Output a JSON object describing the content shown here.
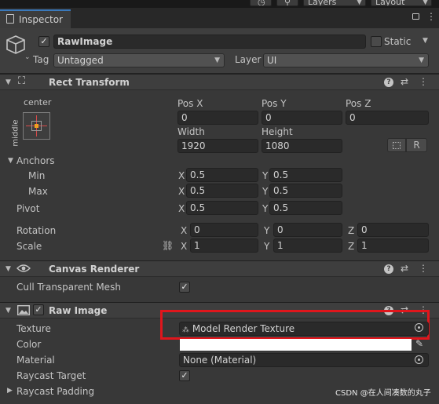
{
  "toolbar": {
    "layers_label": "Layers",
    "layout_label": "Layout"
  },
  "tab": {
    "label": "Inspector"
  },
  "header": {
    "object_name": "RawImage",
    "static_label": "Static",
    "tag_label": "Tag",
    "tag_value": "Untagged",
    "layer_label": "Layer",
    "layer_value": "UI"
  },
  "rect_transform": {
    "title": "Rect Transform",
    "anchor_preset_h": "center",
    "anchor_preset_v": "middle",
    "pos_x_label": "Pos X",
    "pos_x": "0",
    "pos_y_label": "Pos Y",
    "pos_y": "0",
    "pos_z_label": "Pos Z",
    "pos_z": "0",
    "width_label": "Width",
    "width": "1920",
    "height_label": "Height",
    "height": "1080",
    "r_label": "R",
    "anchors_label": "Anchors",
    "min_label": "Min",
    "min_x": "0.5",
    "min_y": "0.5",
    "max_label": "Max",
    "max_x": "0.5",
    "max_y": "0.5",
    "pivot_label": "Pivot",
    "pivot_x": "0.5",
    "pivot_y": "0.5",
    "rotation_label": "Rotation",
    "rot_x": "0",
    "rot_y": "0",
    "rot_z": "0",
    "scale_label": "Scale",
    "scale_x": "1",
    "scale_y": "1",
    "scale_z": "1",
    "x_axis": "X",
    "y_axis": "Y",
    "z_axis": "Z"
  },
  "canvas_renderer": {
    "title": "Canvas Renderer",
    "cull_label": "Cull Transparent Mesh",
    "cull_checked": true
  },
  "raw_image": {
    "title": "Raw Image",
    "texture_label": "Texture",
    "texture_value": "Model Render Texture",
    "color_label": "Color",
    "color_value": "#ffffff",
    "material_label": "Material",
    "material_value": "None (Material)",
    "raycast_target_label": "Raycast Target",
    "raycast_padding_label": "Raycast Padding"
  },
  "watermark": "CSDN @在人间凑数的丸子",
  "colors": {
    "highlight_box": "#e0161c",
    "tab_accent": "#3a79bb"
  }
}
